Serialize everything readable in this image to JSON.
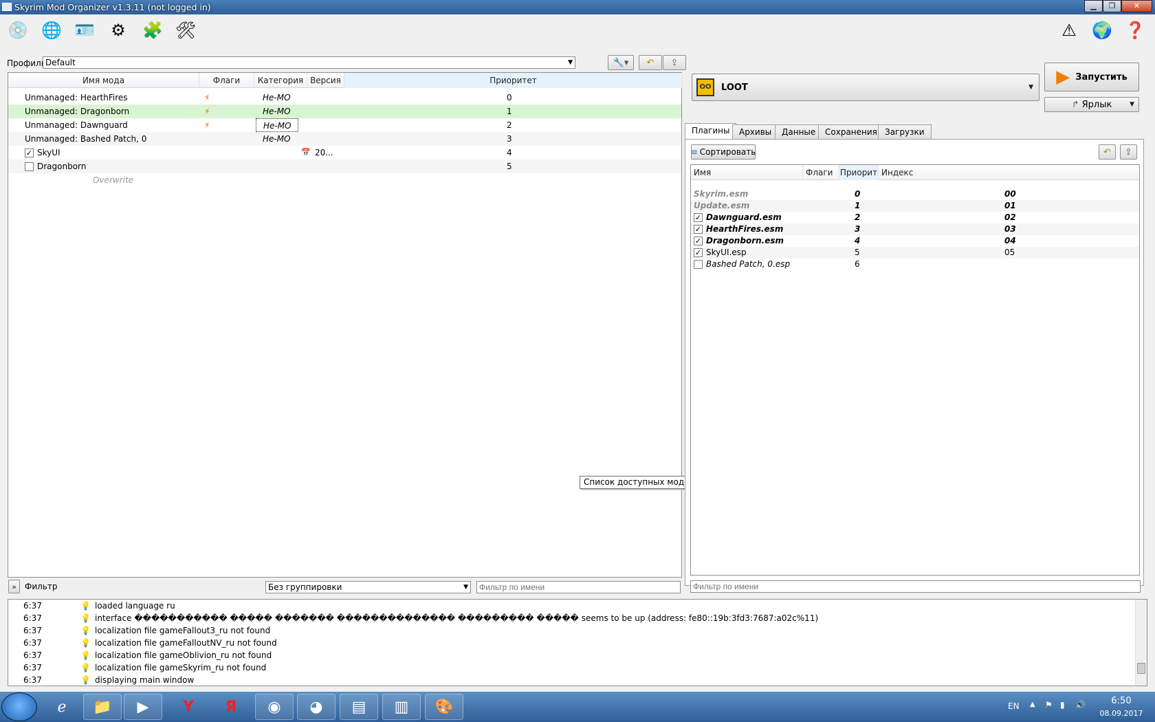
{
  "window": {
    "title": "Skyrim Mod Organizer v1.3.11 (not logged in)"
  },
  "toolbar": {
    "icons": [
      "installer-icon",
      "nexus-globe-icon",
      "profiles-icon",
      "executables-gear-icon",
      "tools-icon",
      "settings-icon",
      "warning-icon",
      "update-icon",
      "help-icon"
    ]
  },
  "profile": {
    "label": "Профиль",
    "value": "Default"
  },
  "mods": {
    "headers": {
      "name": "Имя мода",
      "flags": "Флаги",
      "category": "Категория",
      "version": "Версия",
      "priority": "Приоритет"
    },
    "rows": [
      {
        "name": "Unmanaged: HearthFires",
        "category": "Не-МО",
        "priority": "0"
      },
      {
        "name": "Unmanaged: Dragonborn",
        "category": "Не-МО",
        "priority": "1"
      },
      {
        "name": "Unmanaged: Dawnguard",
        "category": "Не-МО",
        "priority": "2"
      },
      {
        "name": "Unmanaged: Bashed Patch, 0",
        "category": "Не-МО",
        "priority": "3"
      },
      {
        "name": "SkyUI",
        "version": "20...",
        "priority": "4"
      },
      {
        "name": "Dragonborn",
        "priority": "5"
      }
    ],
    "overwrite": "Overwrite",
    "tooltip": "Список доступных модов."
  },
  "filterbar": {
    "toggle": "»",
    "label": "Фильтр",
    "grouping": "Без группировки",
    "name_placeholder": "Фильтр по имени"
  },
  "runner": {
    "executable": "LOOT",
    "run_label": "Запустить",
    "shortcut_label": "Ярлык"
  },
  "tabs": [
    "Плагины",
    "Архивы",
    "Данные",
    "Сохранения",
    "Загрузки"
  ],
  "plugins": {
    "sort_label": "Сортировать",
    "headers": {
      "name": "Имя",
      "flags": "Флаги",
      "priority": "Приорит",
      "index": "Индекс"
    },
    "rows": [
      {
        "name": "Skyrim.esm",
        "priority": "0",
        "index": "00"
      },
      {
        "name": "Update.esm",
        "priority": "1",
        "index": "01"
      },
      {
        "name": "Dawnguard.esm",
        "priority": "2",
        "index": "02"
      },
      {
        "name": "HearthFires.esm",
        "priority": "3",
        "index": "03"
      },
      {
        "name": "Dragonborn.esm",
        "priority": "4",
        "index": "04"
      },
      {
        "name": "SkyUI.esp",
        "priority": "5",
        "index": "05"
      },
      {
        "name": "Bashed Patch, 0.esp",
        "priority": "6",
        "index": ""
      }
    ],
    "filter_placeholder": "Фильтр по имени"
  },
  "log": [
    {
      "time": "6:37",
      "msg": "loaded language ru"
    },
    {
      "time": "6:37",
      "msg": "interface ����������� ����� ������� �������������� ��������� ����� seems to be up (address: fe80::19b:3fd3:7687:a02c%11)"
    },
    {
      "time": "6:37",
      "msg": "localization file gameFallout3_ru not found"
    },
    {
      "time": "6:37",
      "msg": "localization file gameFalloutNV_ru not found"
    },
    {
      "time": "6:37",
      "msg": "localization file gameOblivion_ru not found"
    },
    {
      "time": "6:37",
      "msg": "localization file gameSkyrim_ru not found"
    },
    {
      "time": "6:37",
      "msg": "displaying main window"
    }
  ],
  "taskbar": {
    "lang": "EN",
    "time": "6:50",
    "date": "08.09.2017"
  }
}
